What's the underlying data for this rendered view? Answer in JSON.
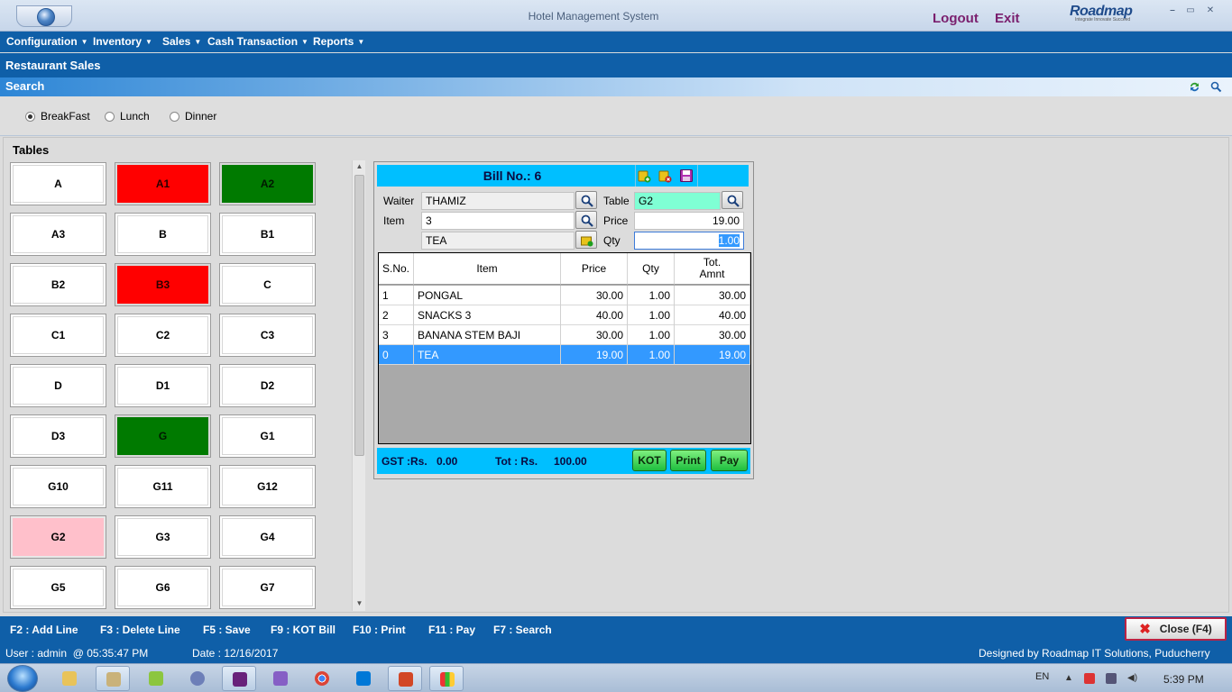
{
  "window": {
    "title": "Hotel Management System",
    "logout": "Logout",
    "exit": "Exit",
    "brand": "Roadmap",
    "brand_tagline": "Integrate Innovate Succeed",
    "min": "⎯",
    "restore": "▭",
    "close": "✕"
  },
  "menu": [
    {
      "label": "Configuration"
    },
    {
      "label": "Inventory"
    },
    {
      "label": "Sales"
    },
    {
      "label": "Cash Transaction"
    },
    {
      "label": "Reports"
    }
  ],
  "section_title": "Restaurant Sales",
  "search": {
    "label": "Search"
  },
  "meals": {
    "options": [
      "BreakFast",
      "Lunch",
      "Dinner"
    ],
    "selected": "BreakFast"
  },
  "tables": {
    "title": "Tables",
    "items": [
      {
        "name": "A",
        "status": "free"
      },
      {
        "name": "A1",
        "status": "red"
      },
      {
        "name": "A2",
        "status": "green"
      },
      {
        "name": "A3",
        "status": "free"
      },
      {
        "name": "B",
        "status": "free"
      },
      {
        "name": "B1",
        "status": "free"
      },
      {
        "name": "B2",
        "status": "free"
      },
      {
        "name": "B3",
        "status": "red"
      },
      {
        "name": "C",
        "status": "free"
      },
      {
        "name": "C1",
        "status": "free"
      },
      {
        "name": "C2",
        "status": "free"
      },
      {
        "name": "C3",
        "status": "free"
      },
      {
        "name": "D",
        "status": "free"
      },
      {
        "name": "D1",
        "status": "free"
      },
      {
        "name": "D2",
        "status": "free"
      },
      {
        "name": "D3",
        "status": "free"
      },
      {
        "name": "G",
        "status": "green"
      },
      {
        "name": "G1",
        "status": "free"
      },
      {
        "name": "G10",
        "status": "free"
      },
      {
        "name": "G11",
        "status": "free"
      },
      {
        "name": "G12",
        "status": "free"
      },
      {
        "name": "G2",
        "status": "selected"
      },
      {
        "name": "G3",
        "status": "free"
      },
      {
        "name": "G4",
        "status": "free"
      },
      {
        "name": "G5",
        "status": "free"
      },
      {
        "name": "G6",
        "status": "free"
      },
      {
        "name": "G7",
        "status": "free"
      }
    ]
  },
  "bill": {
    "title": "Bill No.: 6",
    "waiter_label": "Waiter",
    "waiter": "THAMIZ",
    "table_label": "Table",
    "table": "G2",
    "item_label": "Item",
    "item_code": "3",
    "item_name": "TEA",
    "price_label": "Price",
    "price": "19.00",
    "qty_label": "Qty",
    "qty": "1.00",
    "columns": [
      "S.No.",
      "Item",
      "Price",
      "Qty",
      "Tot.\nAmnt"
    ],
    "rows": [
      {
        "sno": "1",
        "item": "PONGAL",
        "price": "30.00",
        "qty": "1.00",
        "total": "30.00"
      },
      {
        "sno": "2",
        "item": "SNACKS 3",
        "price": "40.00",
        "qty": "1.00",
        "total": "40.00"
      },
      {
        "sno": "3",
        "item": "BANANA STEM BAJI",
        "price": "30.00",
        "qty": "1.00",
        "total": "30.00"
      },
      {
        "sno": "0",
        "item": "TEA",
        "price": "19.00",
        "qty": "1.00",
        "total": "19.00",
        "selected": true
      }
    ],
    "gst_label": "GST :Rs.",
    "gst": "0.00",
    "tot_label": "Tot : Rs.",
    "tot": "100.00",
    "kot": "KOT",
    "print": "Print",
    "pay": "Pay"
  },
  "shortcuts": [
    "F2 : Add Line",
    "F3 : Delete Line",
    "F5 : Save",
    "F9 : KOT Bill",
    "F10 : Print",
    "F11 : Pay",
    "F7 : Search"
  ],
  "close_label": "Close (F4)",
  "status": {
    "user": "User : admin  @ 05:35:47 PM",
    "date": "Date : 12/16/2017",
    "credit": "Designed by Roadmap IT Solutions, Puducherry"
  },
  "taskbar": {
    "lang": "EN",
    "time": "5:39 PM"
  },
  "colors": {
    "header_blue": "#0f5fa8",
    "cyan": "#00bfff",
    "occupied_red": "#ff0000",
    "occupied_green": "#007a00",
    "selected_pink": "#ffc0cb",
    "row_select": "#3399ff"
  }
}
